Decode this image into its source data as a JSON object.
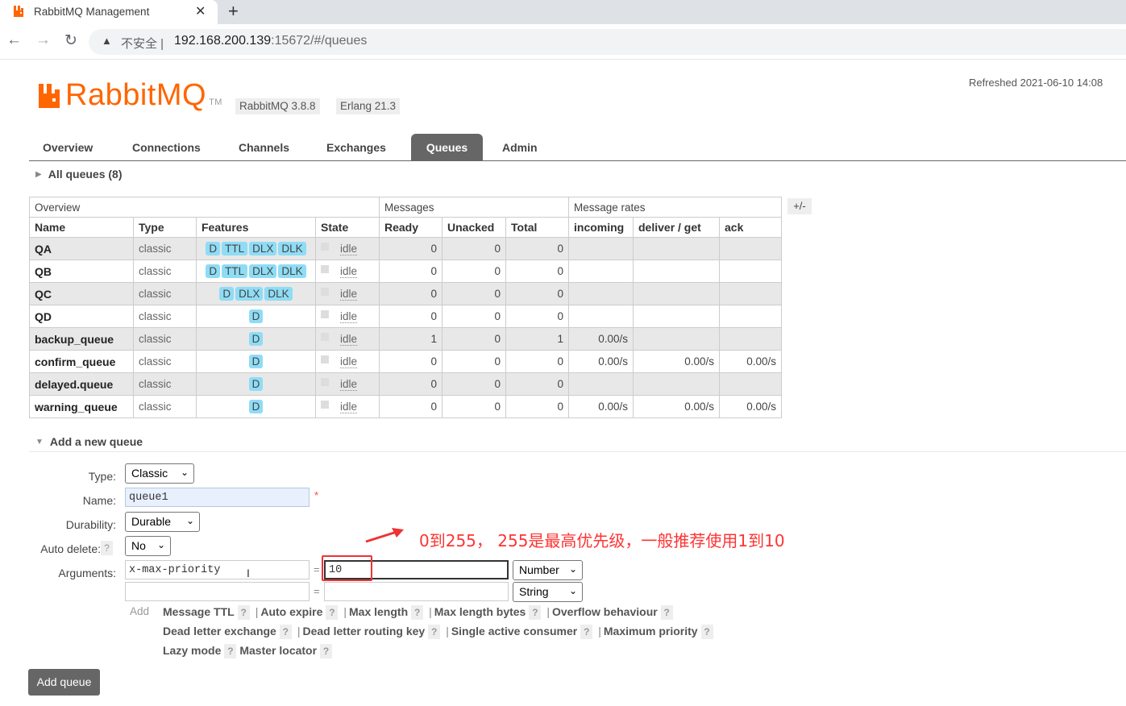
{
  "browser": {
    "tab_title": "RabbitMQ Management",
    "security_label": "不安全",
    "url_host": "192.168.200.139",
    "url_rest": ":15672/#/queues"
  },
  "header": {
    "logo_text": "RabbitMQ",
    "logo_tm": "TM",
    "version": "RabbitMQ 3.8.8",
    "erlang": "Erlang 21.3",
    "refreshed": "Refreshed 2021-06-10 14:08"
  },
  "nav": {
    "tabs": [
      "Overview",
      "Connections",
      "Channels",
      "Exchanges",
      "Queues",
      "Admin"
    ],
    "active": "Queues"
  },
  "queues": {
    "section_title": "All queues (8)",
    "group_overview": "Overview",
    "group_messages": "Messages",
    "group_rates": "Message rates",
    "plusminus": "+/-",
    "columns": [
      "Name",
      "Type",
      "Features",
      "State",
      "Ready",
      "Unacked",
      "Total",
      "incoming",
      "deliver / get",
      "ack"
    ],
    "rows": [
      {
        "name": "QA",
        "type": "classic",
        "features": [
          "D",
          "TTL",
          "DLX",
          "DLK"
        ],
        "state": "idle",
        "ready": "0",
        "unacked": "0",
        "total": "0",
        "incoming": "",
        "deliver": "",
        "ack": ""
      },
      {
        "name": "QB",
        "type": "classic",
        "features": [
          "D",
          "TTL",
          "DLX",
          "DLK"
        ],
        "state": "idle",
        "ready": "0",
        "unacked": "0",
        "total": "0",
        "incoming": "",
        "deliver": "",
        "ack": ""
      },
      {
        "name": "QC",
        "type": "classic",
        "features": [
          "D",
          "DLX",
          "DLK"
        ],
        "state": "idle",
        "ready": "0",
        "unacked": "0",
        "total": "0",
        "incoming": "",
        "deliver": "",
        "ack": ""
      },
      {
        "name": "QD",
        "type": "classic",
        "features": [
          "D"
        ],
        "state": "idle",
        "ready": "0",
        "unacked": "0",
        "total": "0",
        "incoming": "",
        "deliver": "",
        "ack": ""
      },
      {
        "name": "backup_queue",
        "type": "classic",
        "features": [
          "D"
        ],
        "state": "idle",
        "ready": "1",
        "unacked": "0",
        "total": "1",
        "incoming": "0.00/s",
        "deliver": "",
        "ack": ""
      },
      {
        "name": "confirm_queue",
        "type": "classic",
        "features": [
          "D"
        ],
        "state": "idle",
        "ready": "0",
        "unacked": "0",
        "total": "0",
        "incoming": "0.00/s",
        "deliver": "0.00/s",
        "ack": "0.00/s"
      },
      {
        "name": "delayed.queue",
        "type": "classic",
        "features": [
          "D"
        ],
        "state": "idle",
        "ready": "0",
        "unacked": "0",
        "total": "0",
        "incoming": "",
        "deliver": "",
        "ack": ""
      },
      {
        "name": "warning_queue",
        "type": "classic",
        "features": [
          "D"
        ],
        "state": "idle",
        "ready": "0",
        "unacked": "0",
        "total": "0",
        "incoming": "0.00/s",
        "deliver": "0.00/s",
        "ack": "0.00/s"
      }
    ]
  },
  "add_queue": {
    "section_title": "Add a new queue",
    "type_label": "Type:",
    "type_value": "Classic",
    "name_label": "Name:",
    "name_value": "queue1",
    "required_mark": "*",
    "durability_label": "Durability:",
    "durability_value": "Durable",
    "auto_delete_label": "Auto delete:",
    "auto_delete_help": "?",
    "auto_delete_value": "No",
    "arguments_label": "Arguments:",
    "arg1_key": "x-max-priority",
    "arg1_value": "10",
    "arg1_type": "Number",
    "arg2_key": "",
    "arg2_value": "",
    "arg2_type": "String",
    "eq": "=",
    "add_label": "Add",
    "arg_links_row1": [
      "Message TTL",
      "Auto expire",
      "Max length",
      "Max length bytes",
      "Overflow behaviour"
    ],
    "arg_links_row2": [
      "Dead letter exchange",
      "Dead letter routing key",
      "Single active consumer",
      "Maximum priority"
    ],
    "arg_links_row3": [
      "Lazy mode",
      "Master locator"
    ],
    "help": "?",
    "separator": "|",
    "submit": "Add queue"
  },
  "annotation": {
    "text": "0到255，  255是最高优先级，一般推荐使用1到10",
    "color": "#ff3333"
  }
}
